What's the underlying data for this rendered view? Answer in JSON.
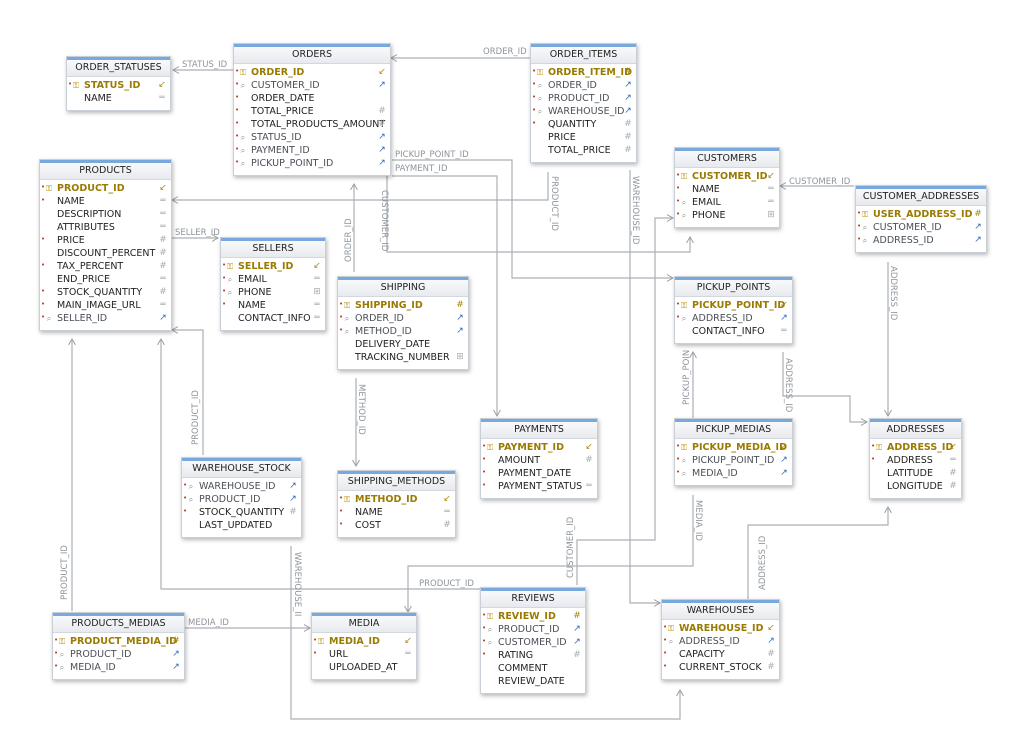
{
  "tables": {
    "order_statuses": {
      "title": "ORDER_STATUSES",
      "columns": [
        {
          "name": "STATUS_ID",
          "key": "pk",
          "type_icon": "key-arrow-icon",
          "required": true
        },
        {
          "name": "NAME",
          "key": "",
          "type_icon": "text-type-icon",
          "required": false
        }
      ]
    },
    "orders": {
      "title": "ORDERS",
      "columns": [
        {
          "name": "ORDER_ID",
          "key": "pk",
          "type_icon": "key-arrow-icon",
          "required": true
        },
        {
          "name": "CUSTOMER_ID",
          "key": "fk",
          "type_icon": "foreign-key-icon",
          "required": true
        },
        {
          "name": "ORDER_DATE",
          "key": "",
          "type_icon": "",
          "required": true
        },
        {
          "name": "TOTAL_PRICE",
          "key": "",
          "type_icon": "numeric-type-icon",
          "required": true
        },
        {
          "name": "TOTAL_PRODUCTS_AMOUNT",
          "key": "",
          "type_icon": "numeric-type-icon",
          "required": true
        },
        {
          "name": "STATUS_ID",
          "key": "fk",
          "type_icon": "foreign-key-icon",
          "required": true
        },
        {
          "name": "PAYMENT_ID",
          "key": "fk",
          "type_icon": "foreign-key-icon",
          "required": true
        },
        {
          "name": "PICKUP_POINT_ID",
          "key": "fk",
          "type_icon": "foreign-key-icon",
          "required": true
        }
      ]
    },
    "order_items": {
      "title": "ORDER_ITEMS",
      "columns": [
        {
          "name": "ORDER_ITEM_ID",
          "key": "pk",
          "type_icon": "numeric-type-icon",
          "required": true
        },
        {
          "name": "ORDER_ID",
          "key": "fk",
          "type_icon": "foreign-key-icon",
          "required": true
        },
        {
          "name": "PRODUCT_ID",
          "key": "fk",
          "type_icon": "foreign-key-icon",
          "required": true
        },
        {
          "name": "WAREHOUSE_ID",
          "key": "fk",
          "type_icon": "foreign-key-icon",
          "required": true
        },
        {
          "name": "QUANTITY",
          "key": "",
          "type_icon": "numeric-type-icon",
          "required": true
        },
        {
          "name": "PRICE",
          "key": "",
          "type_icon": "numeric-type-icon",
          "required": false
        },
        {
          "name": "TOTAL_PRICE",
          "key": "",
          "type_icon": "numeric-type-icon",
          "required": false
        }
      ]
    },
    "products": {
      "title": "PRODUCTS",
      "columns": [
        {
          "name": "PRODUCT_ID",
          "key": "pk",
          "type_icon": "key-arrow-icon",
          "required": true
        },
        {
          "name": "NAME",
          "key": "",
          "type_icon": "text-type-icon",
          "required": true
        },
        {
          "name": "DESCRIPTION",
          "key": "",
          "type_icon": "text-type-icon",
          "required": false
        },
        {
          "name": "ATTRIBUTES",
          "key": "",
          "type_icon": "text-type-icon",
          "required": false
        },
        {
          "name": "PRICE",
          "key": "",
          "type_icon": "numeric-type-icon",
          "required": true
        },
        {
          "name": "DISCOUNT_PERCENT",
          "key": "",
          "type_icon": "numeric-type-icon",
          "required": false
        },
        {
          "name": "TAX_PERCENT",
          "key": "",
          "type_icon": "numeric-type-icon",
          "required": true
        },
        {
          "name": "END_PRICE",
          "key": "",
          "type_icon": "text-type-icon",
          "required": false
        },
        {
          "name": "STOCK_QUANTITY",
          "key": "",
          "type_icon": "numeric-type-icon",
          "required": true
        },
        {
          "name": "MAIN_IMAGE_URL",
          "key": "",
          "type_icon": "text-type-icon",
          "required": true
        },
        {
          "name": "SELLER_ID",
          "key": "fk",
          "type_icon": "foreign-key-icon",
          "required": true
        }
      ]
    },
    "sellers": {
      "title": "SELLERS",
      "columns": [
        {
          "name": "SELLER_ID",
          "key": "pk",
          "type_icon": "key-arrow-icon",
          "required": true
        },
        {
          "name": "EMAIL",
          "key": "uk",
          "type_icon": "text-type-icon",
          "required": true
        },
        {
          "name": "PHONE",
          "key": "uk",
          "type_icon": "date-type-icon",
          "required": true
        },
        {
          "name": "NAME",
          "key": "",
          "type_icon": "text-type-icon",
          "required": true
        },
        {
          "name": "CONTACT_INFO",
          "key": "",
          "type_icon": "text-type-icon",
          "required": false
        }
      ]
    },
    "shipping": {
      "title": "SHIPPING",
      "columns": [
        {
          "name": "SHIPPING_ID",
          "key": "pk",
          "type_icon": "numeric-type-icon",
          "required": true
        },
        {
          "name": "ORDER_ID",
          "key": "fk",
          "type_icon": "foreign-key-icon",
          "required": true
        },
        {
          "name": "METHOD_ID",
          "key": "fk",
          "type_icon": "foreign-key-icon",
          "required": true
        },
        {
          "name": "DELIVERY_DATE",
          "key": "",
          "type_icon": "",
          "required": false
        },
        {
          "name": "TRACKING_NUMBER",
          "key": "",
          "type_icon": "date-type-icon",
          "required": false
        }
      ]
    },
    "customers": {
      "title": "CUSTOMERS",
      "columns": [
        {
          "name": "CUSTOMER_ID",
          "key": "pk",
          "type_icon": "key-arrow-icon",
          "required": true
        },
        {
          "name": "NAME",
          "key": "",
          "type_icon": "text-type-icon",
          "required": true
        },
        {
          "name": "EMAIL",
          "key": "uk",
          "type_icon": "text-type-icon",
          "required": true
        },
        {
          "name": "PHONE",
          "key": "uk",
          "type_icon": "date-type-icon",
          "required": true
        }
      ]
    },
    "customer_addresses": {
      "title": "CUSTOMER_ADDRESSES",
      "columns": [
        {
          "name": "USER_ADDRESS_ID",
          "key": "pk",
          "type_icon": "numeric-type-icon",
          "required": true
        },
        {
          "name": "CUSTOMER_ID",
          "key": "fk",
          "type_icon": "foreign-key-icon",
          "required": true
        },
        {
          "name": "ADDRESS_ID",
          "key": "fk",
          "type_icon": "foreign-key-icon",
          "required": true
        }
      ]
    },
    "pickup_points": {
      "title": "PICKUP_POINTS",
      "columns": [
        {
          "name": "PICKUP_POINT_ID",
          "key": "pk",
          "type_icon": "key-arrow-icon",
          "required": true
        },
        {
          "name": "ADDRESS_ID",
          "key": "fk",
          "type_icon": "foreign-key-icon",
          "required": true
        },
        {
          "name": "CONTACT_INFO",
          "key": "",
          "type_icon": "text-type-icon",
          "required": false
        }
      ]
    },
    "warehouse_stock": {
      "title": "WAREHOUSE_STOCK",
      "columns": [
        {
          "name": "WAREHOUSE_ID",
          "key": "fk",
          "type_icon": "foreign-key-icon",
          "required": true
        },
        {
          "name": "PRODUCT_ID",
          "key": "fk",
          "type_icon": "foreign-key-icon",
          "required": true
        },
        {
          "name": "STOCK_QUANTITY",
          "key": "",
          "type_icon": "numeric-type-icon",
          "required": true
        },
        {
          "name": "LAST_UPDATED",
          "key": "",
          "type_icon": "",
          "required": false
        }
      ]
    },
    "shipping_methods": {
      "title": "SHIPPING_METHODS",
      "columns": [
        {
          "name": "METHOD_ID",
          "key": "pk",
          "type_icon": "key-arrow-icon",
          "required": true
        },
        {
          "name": "NAME",
          "key": "",
          "type_icon": "text-type-icon",
          "required": true
        },
        {
          "name": "COST",
          "key": "",
          "type_icon": "numeric-type-icon",
          "required": true
        }
      ]
    },
    "payments": {
      "title": "PAYMENTS",
      "columns": [
        {
          "name": "PAYMENT_ID",
          "key": "pk",
          "type_icon": "key-arrow-icon",
          "required": true
        },
        {
          "name": "AMOUNT",
          "key": "",
          "type_icon": "numeric-type-icon",
          "required": true
        },
        {
          "name": "PAYMENT_DATE",
          "key": "",
          "type_icon": "",
          "required": true
        },
        {
          "name": "PAYMENT_STATUS",
          "key": "",
          "type_icon": "text-type-icon",
          "required": true
        }
      ]
    },
    "pickup_medias": {
      "title": "PICKUP_MEDIAS",
      "columns": [
        {
          "name": "PICKUP_MEDIA_ID",
          "key": "pk",
          "type_icon": "key-arrow-icon",
          "required": true
        },
        {
          "name": "PICKUP_POINT_ID",
          "key": "fk",
          "type_icon": "foreign-key-icon",
          "required": true
        },
        {
          "name": "MEDIA_ID",
          "key": "fk",
          "type_icon": "foreign-key-icon",
          "required": true
        }
      ]
    },
    "addresses": {
      "title": "ADDRESSES",
      "columns": [
        {
          "name": "ADDRESS_ID",
          "key": "pk",
          "type_icon": "key-arrow-icon",
          "required": true
        },
        {
          "name": "ADDRESS",
          "key": "",
          "type_icon": "text-type-icon",
          "required": true
        },
        {
          "name": "LATITUDE",
          "key": "",
          "type_icon": "numeric-type-icon",
          "required": false
        },
        {
          "name": "LONGITUDE",
          "key": "",
          "type_icon": "numeric-type-icon",
          "required": false
        }
      ]
    },
    "products_medias": {
      "title": "PRODUCTS_MEDIAS",
      "columns": [
        {
          "name": "PRODUCT_MEDIA_ID",
          "key": "pk",
          "type_icon": "numeric-type-icon",
          "required": true
        },
        {
          "name": "PRODUCT_ID",
          "key": "fk",
          "type_icon": "foreign-key-icon",
          "required": true
        },
        {
          "name": "MEDIA_ID",
          "key": "fk",
          "type_icon": "foreign-key-icon",
          "required": true
        }
      ]
    },
    "media": {
      "title": "MEDIA",
      "columns": [
        {
          "name": "MEDIA_ID",
          "key": "pk",
          "type_icon": "key-arrow-icon",
          "required": true
        },
        {
          "name": "URL",
          "key": "",
          "type_icon": "text-type-icon",
          "required": true
        },
        {
          "name": "UPLOADED_AT",
          "key": "",
          "type_icon": "",
          "required": false
        }
      ]
    },
    "reviews": {
      "title": "REVIEWS",
      "columns": [
        {
          "name": "REVIEW_ID",
          "key": "pk",
          "type_icon": "numeric-type-icon",
          "required": true
        },
        {
          "name": "PRODUCT_ID",
          "key": "fk",
          "type_icon": "foreign-key-icon",
          "required": true
        },
        {
          "name": "CUSTOMER_ID",
          "key": "fk",
          "type_icon": "foreign-key-icon",
          "required": true
        },
        {
          "name": "RATING",
          "key": "",
          "type_icon": "numeric-type-icon",
          "required": true
        },
        {
          "name": "COMMENT",
          "key": "",
          "type_icon": "",
          "required": false
        },
        {
          "name": "REVIEW_DATE",
          "key": "",
          "type_icon": "",
          "required": false
        }
      ]
    },
    "warehouses": {
      "title": "WAREHOUSES",
      "columns": [
        {
          "name": "WAREHOUSE_ID",
          "key": "pk",
          "type_icon": "key-arrow-icon",
          "required": true
        },
        {
          "name": "ADDRESS_ID",
          "key": "fk",
          "type_icon": "foreign-key-icon",
          "required": true
        },
        {
          "name": "CAPACITY",
          "key": "",
          "type_icon": "numeric-type-icon",
          "required": true
        },
        {
          "name": "CURRENT_STOCK",
          "key": "",
          "type_icon": "numeric-type-icon",
          "required": true
        }
      ]
    }
  },
  "relationship_labels": [
    "STATUS_ID",
    "ORDER_ID",
    "CUSTOMER_ID",
    "PICKUP_POINT_ID",
    "PAYMENT_ID",
    "CUSTOMER_ID",
    "PRODUCT_ID",
    "WAREHOUSE_ID",
    "SELLER_ID",
    "ORDER_ID",
    "METHOD_ID",
    "PRODUCT_ID",
    "ADDRESS_ID",
    "PICKUP_POIN",
    "ADDRESS_ID",
    "MEDIA_ID",
    "CUSTOMER_ID",
    "ADDRESS_ID",
    "PRODUCT_ID",
    "PRODUCT_ID",
    "WAREHOUSE_II",
    "MEDIA_ID"
  ],
  "colors": {
    "header_accent": "#79a8dc",
    "primary_key_text": "#9a7a00",
    "foreign_key_icon": "#2d68b5",
    "relationship_line": "#a9aeb4",
    "relationship_label": "#8e949b"
  }
}
